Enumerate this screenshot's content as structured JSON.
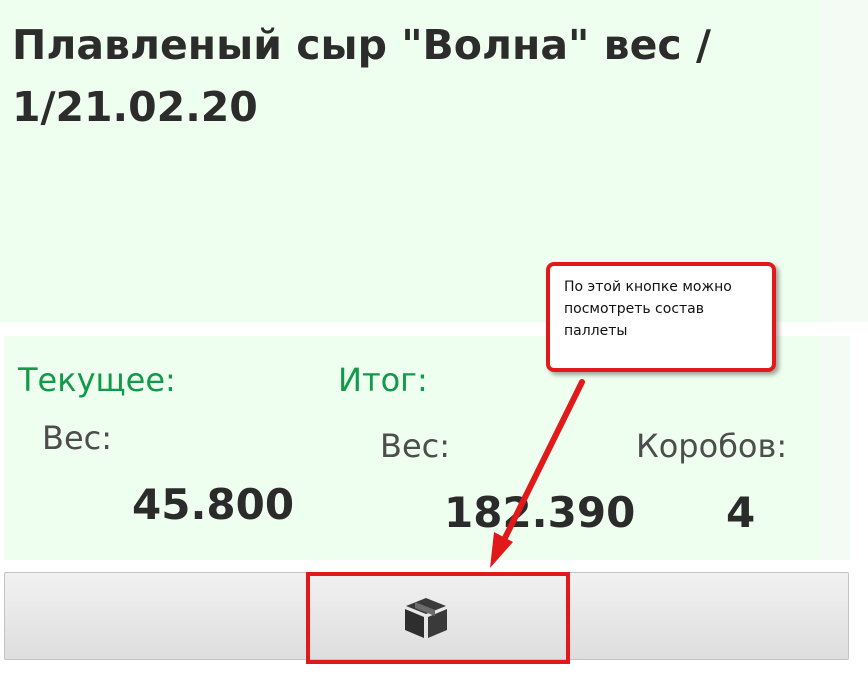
{
  "product": {
    "title": "Плавленый сыр \"Волна\" вес / 1/21.02.20"
  },
  "current": {
    "label": "Текущее:",
    "weight_label": "Вес:",
    "weight_value": "45.800"
  },
  "total": {
    "label": "Итог:",
    "weight_label": "Вес:",
    "weight_value": "182.390",
    "boxes_label": "Коробов:",
    "boxes_value": "4"
  },
  "callout": {
    "text": "По этой кнопке можно посмотреть состав паллеты"
  },
  "action_bar": {
    "pallet_button_icon": "box-icon"
  },
  "colors": {
    "panel_background": "#efffef",
    "section_label": "#13994a",
    "annotation_red": "#e2191b",
    "text_dark": "#2c2c2c"
  }
}
